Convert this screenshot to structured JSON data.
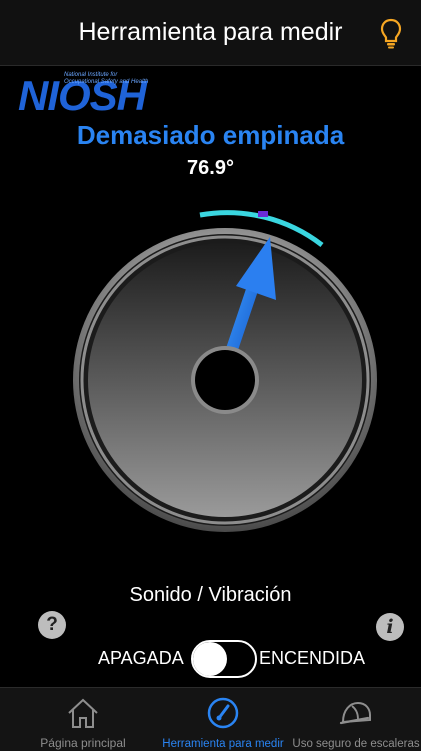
{
  "header": {
    "title": "Herramienta para medir",
    "hint_icon": "lightbulb-icon"
  },
  "logo": {
    "word": "NIOSH",
    "subtitle_line1": "National Institute for",
    "subtitle_line2": "Occupational Safety and Health"
  },
  "reading": {
    "status": "Demasiado empinada",
    "angle": "76.9°",
    "status_color": "#2a84f2"
  },
  "controls": {
    "sound_label": "Sonido / Vibración",
    "toggle_off_label": "APAGADA",
    "toggle_on_label": "ENCENDIDA",
    "toggle_on": false,
    "help_symbol": "?",
    "info_symbol": "i"
  },
  "tabs": [
    {
      "label": "Página principal",
      "icon": "home-icon",
      "active": false
    },
    {
      "label": "Herramienta para medir",
      "icon": "gauge-icon",
      "active": true
    },
    {
      "label": "Uso seguro de escaleras",
      "icon": "hard-hat-icon",
      "active": false
    }
  ],
  "colors": {
    "accent": "#2a84f2",
    "background": "#000000",
    "tab_inactive": "#8e8e8e",
    "indicator_teal": "#3ad6e0",
    "indicator_purple": "#6a2bd6"
  }
}
